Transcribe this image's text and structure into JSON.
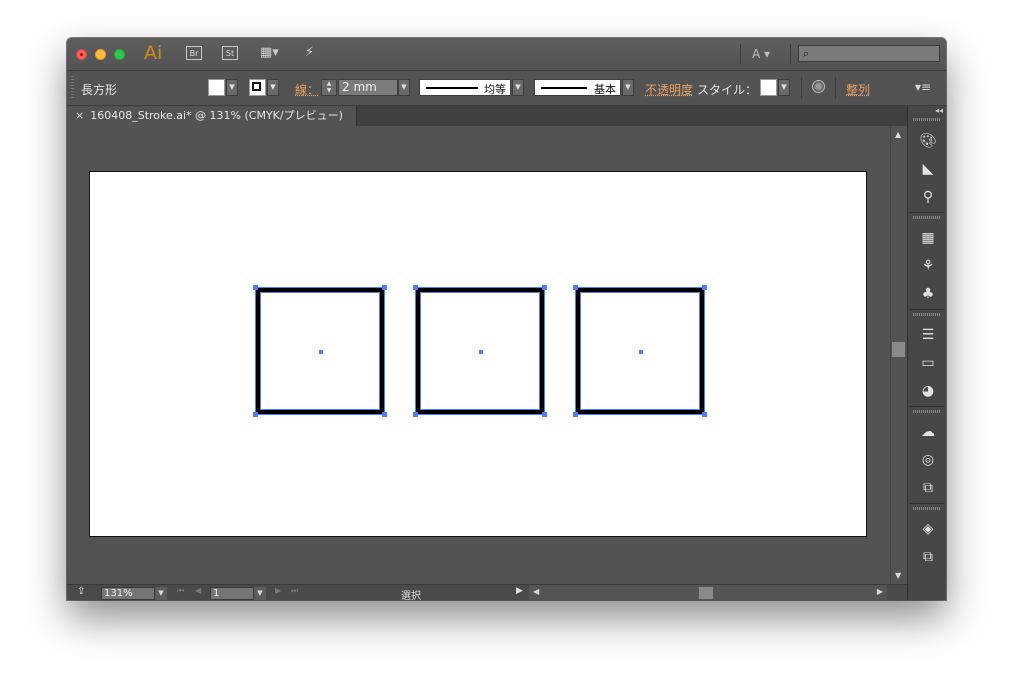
{
  "app": {
    "logo": "Ai",
    "bridge_btn": "Br",
    "stock_btn": "St",
    "font_selector": "A ▾",
    "search_placeholder": ""
  },
  "control_bar": {
    "object_type": "長方形",
    "stroke_label": "線：",
    "stroke_weight": "2 mm",
    "profile_label": "均等",
    "brush_label": "基本",
    "opacity_label": "不透明度",
    "style_label": "スタイル：",
    "align_label": "整列"
  },
  "document_tab": {
    "close": "×",
    "title": "160408_Stroke.ai* @ 131% (CMYK/プレビュー)"
  },
  "canvas": {
    "rectangles": [
      {
        "name": "rect-1"
      },
      {
        "name": "rect-2"
      },
      {
        "name": "rect-3"
      }
    ]
  },
  "status_bar": {
    "zoom": "131%",
    "artboard_number": "1",
    "tool_status": "選択"
  },
  "dock": {
    "icons": [
      "color-icon",
      "color-guide-icon",
      "swatches-symbols-icon",
      "swatches-icon",
      "brushes-icon",
      "symbols-icon",
      "stroke-icon",
      "gradient-icon",
      "transparency-icon",
      "cc-libraries-icon",
      "appearance-icon",
      "asset-export-icon",
      "layers-icon",
      "artboards-icon"
    ]
  },
  "colors": {
    "selection": "#4d7dff",
    "ui_background": "#535353",
    "accent_orange": "#e8a165"
  }
}
